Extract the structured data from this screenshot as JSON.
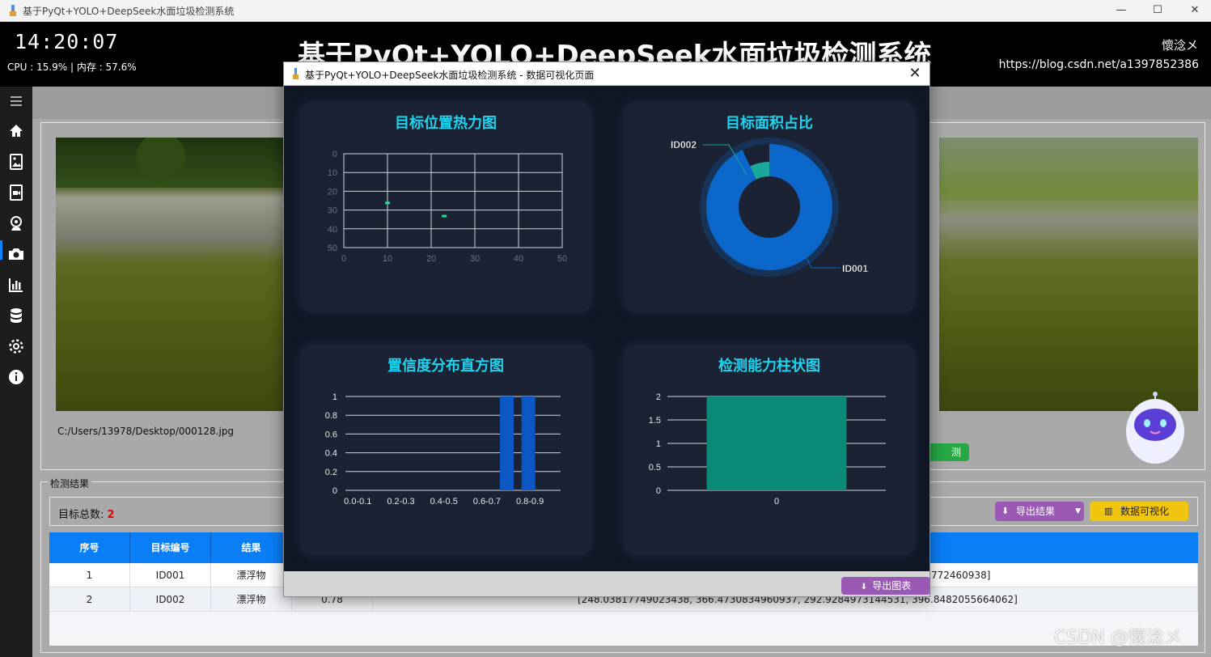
{
  "window": {
    "title": "基于PyQt+YOLO+DeepSeek水面垃圾检测系统",
    "minimize": "—",
    "maximize": "☐",
    "close": "✕"
  },
  "header": {
    "clock": "14:20:07",
    "sysinfo": "CPU : 15.9%   |   内存 : 57.6%",
    "title": "基于PyQt+YOLO+DeepSeek水面垃圾检测系统",
    "author": "懷淰メ",
    "blog": "https://blog.csdn.net/a1397852386"
  },
  "sidebar": {
    "items": [
      "menu-icon",
      "home-icon",
      "image-icon",
      "video-icon",
      "webcam-icon",
      "camera-icon",
      "chart-icon",
      "database-icon",
      "settings-icon",
      "info-icon"
    ],
    "active": "image-icon",
    "accent": "#0a84ff"
  },
  "main": {
    "file_path": "C:/Users/13978/Desktop/000128.jpg",
    "detect_button": "测",
    "results": {
      "legend": "检测结果",
      "total_label": "目标总数: ",
      "total_value": "2",
      "export_button": "导出结果",
      "viz_button": "数据可视化",
      "columns": [
        "序号",
        "目标编号",
        "结果"
      ],
      "rows": [
        {
          "index": "1",
          "id": "ID001",
          "result": "漂浮物",
          "coords": "772460938]"
        },
        {
          "index": "2",
          "id": "ID002",
          "result": "漂浮物",
          "conf": "0.78",
          "coords": "[248.03817749023438, 366.4730834960937, 292.9284973144531, 396.8482055664062]"
        }
      ]
    }
  },
  "dialog": {
    "title": "基于PyQt+YOLO+DeepSeek水面垃圾检测系统 - 数据可视化页面",
    "close": "✕",
    "export_button": "导出图表"
  },
  "watermark": "CSDN @懷淰メ",
  "chart_data": [
    {
      "type": "heatmap",
      "title": "目标位置热力图",
      "xlim": [
        0,
        50
      ],
      "ylim": [
        0,
        50
      ],
      "x_ticks": [
        "0",
        "10",
        "20",
        "30",
        "40",
        "50"
      ],
      "y_ticks": [
        "0",
        "10",
        "20",
        "30",
        "40",
        "50"
      ],
      "points": [
        {
          "x": 10,
          "y": 26
        },
        {
          "x": 23,
          "y": 33
        }
      ],
      "grid": true
    },
    {
      "type": "pie",
      "title": "目标面积占比",
      "labels": [
        "ID001",
        "ID002"
      ],
      "values": [
        93,
        7
      ],
      "colors": [
        "#0b67c9",
        "#1aa89a"
      ]
    },
    {
      "type": "bar",
      "title": "置信度分布直方图",
      "categories": [
        "0.0-0.1",
        "0.1-0.2",
        "0.2-0.3",
        "0.3-0.4",
        "0.4-0.5",
        "0.5-0.6",
        "0.6-0.7",
        "0.7-0.8",
        "0.8-0.9",
        "0.9-1.0"
      ],
      "tick_labels": [
        "0.0-0.1",
        "0.2-0.3",
        "0.4-0.5",
        "0.6-0.7",
        "0.8-0.9"
      ],
      "values": [
        0,
        0,
        0,
        0,
        0,
        0,
        0,
        1,
        1,
        0
      ],
      "y_ticks": [
        "0",
        "0.2",
        "0.4",
        "0.6",
        "0.8",
        "1"
      ],
      "ylim": [
        0,
        1
      ],
      "color": "#0b58c4"
    },
    {
      "type": "bar",
      "title": "检测能力柱状图",
      "categories": [
        "0"
      ],
      "values": [
        2
      ],
      "y_ticks": [
        "0",
        "0.5",
        "1",
        "1.5",
        "2"
      ],
      "ylim": [
        0,
        2
      ],
      "color": "#0b8a77"
    }
  ]
}
